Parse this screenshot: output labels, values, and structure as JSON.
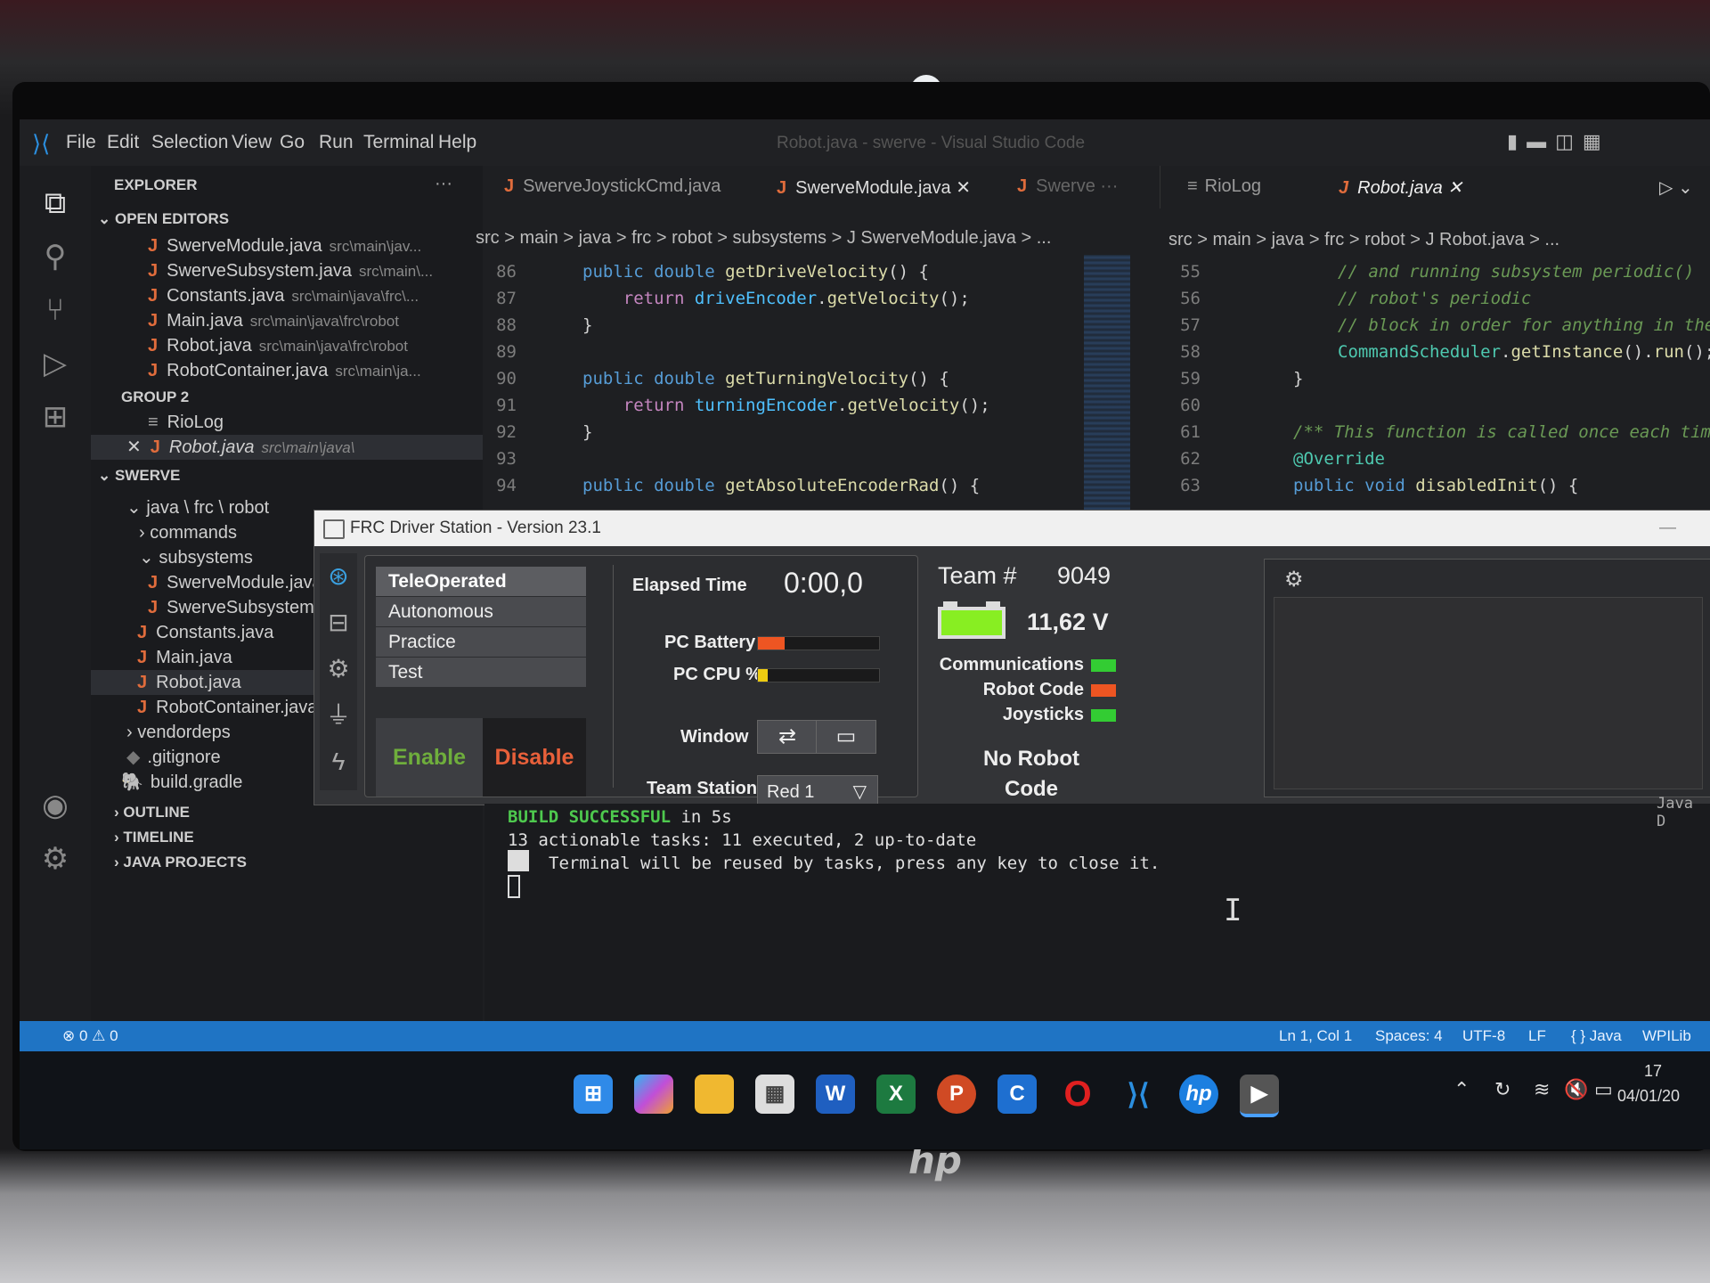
{
  "vscode": {
    "menu": [
      "File",
      "Edit",
      "Selection",
      "View",
      "Go",
      "Run",
      "Terminal",
      "Help"
    ],
    "window_title": "Robot.java - swerve - Visual Studio Code",
    "explorer_title": "EXPLORER",
    "open_editors_title": "OPEN EDITORS",
    "open_editors": [
      {
        "name": "SwerveModule.java",
        "path": "src\\main\\jav..."
      },
      {
        "name": "SwerveSubsystem.java",
        "path": "src\\main\\..."
      },
      {
        "name": "Constants.java",
        "path": "src\\main\\java\\frc\\..."
      },
      {
        "name": "Main.java",
        "path": "src\\main\\java\\frc\\robot"
      },
      {
        "name": "Robot.java",
        "path": "src\\main\\java\\frc\\robot"
      },
      {
        "name": "RobotContainer.java",
        "path": "src\\main\\ja..."
      }
    ],
    "group2_title": "GROUP 2",
    "group2_items": [
      {
        "name": "RioLog"
      },
      {
        "name": "Robot.java",
        "path": "src\\main\\java\\"
      }
    ],
    "project_title": "SWERVE",
    "tree": [
      {
        "label": "java \\ frc \\ robot"
      },
      {
        "label": "commands"
      },
      {
        "label": "subsystems"
      },
      {
        "label": "SwerveModule.java"
      },
      {
        "label": "SwerveSubsystem.java"
      },
      {
        "label": "Constants.java"
      },
      {
        "label": "Main.java"
      },
      {
        "label": "Robot.java"
      },
      {
        "label": "RobotContainer.java"
      },
      {
        "label": "vendordeps"
      },
      {
        "label": ".gitignore"
      },
      {
        "label": "build.gradle"
      }
    ],
    "outline_title": "OUTLINE",
    "timeline_title": "TIMELINE",
    "java_projects_title": "JAVA PROJECTS",
    "left_tabs": [
      "SwerveJoystickCmd.java",
      "SwerveModule.java",
      "Swerve"
    ],
    "left_breadcrumb": "src > main > java > frc > robot > subsystems > J SwerveModule.java > ...",
    "left_code": {
      "line_numbers": [
        "86",
        "87",
        "88",
        "89",
        "90",
        "91",
        "92",
        "93",
        "94"
      ]
    },
    "right_tabs": [
      "RioLog",
      "Robot.java"
    ],
    "right_breadcrumb": "src > main > java > frc > robot > J Robot.java > ...",
    "right_code": {
      "line_numbers": [
        "55",
        "56",
        "57",
        "58",
        "59",
        "60",
        "61",
        "62",
        "63"
      ]
    },
    "terminal": {
      "line1_ok": "BUILD SUCCESSFUL",
      "line1_rest": " in 5s",
      "line2": "13 actionable tasks: 11 executed, 2 up-to-date",
      "line3": "Terminal will be reused by tasks, press any key to close it.",
      "java_label": "Java D"
    },
    "statusbar": {
      "problems": "⊗ 0 ⚠ 0",
      "position": "Ln 1, Col 1",
      "spaces": "Spaces: 4",
      "encoding": "UTF-8",
      "eol": "LF",
      "language": "{ } Java",
      "extension": "WPILib"
    }
  },
  "driver_station": {
    "title": "FRC Driver Station - Version 23.1",
    "modes": [
      "TeleOperated",
      "Autonomous",
      "Practice",
      "Test"
    ],
    "enable_label": "Enable",
    "disable_label": "Disable",
    "elapsed_label": "Elapsed Time",
    "elapsed_value": "0:00,0",
    "pc_battery_label": "PC Battery",
    "pc_battery_level": 0.22,
    "pc_cpu_label": "PC CPU %",
    "pc_cpu_level": 0.08,
    "window_label": "Window",
    "team_station_label": "Team Station",
    "team_station_value": "Red 1",
    "team_label": "Team #",
    "team_number": "9049",
    "voltage": "11,62 V",
    "communications_label": "Communications",
    "robot_code_label": "Robot Code",
    "joysticks_label": "Joysticks",
    "no_robot_code": "No Robot Code",
    "colors": {
      "ok": "#33cc33",
      "bad": "#ee5522",
      "warn": "#eecc11",
      "battery": "#88ee22"
    }
  },
  "taskbar": {
    "clock_time": "17",
    "clock_date": "04/01/20"
  }
}
